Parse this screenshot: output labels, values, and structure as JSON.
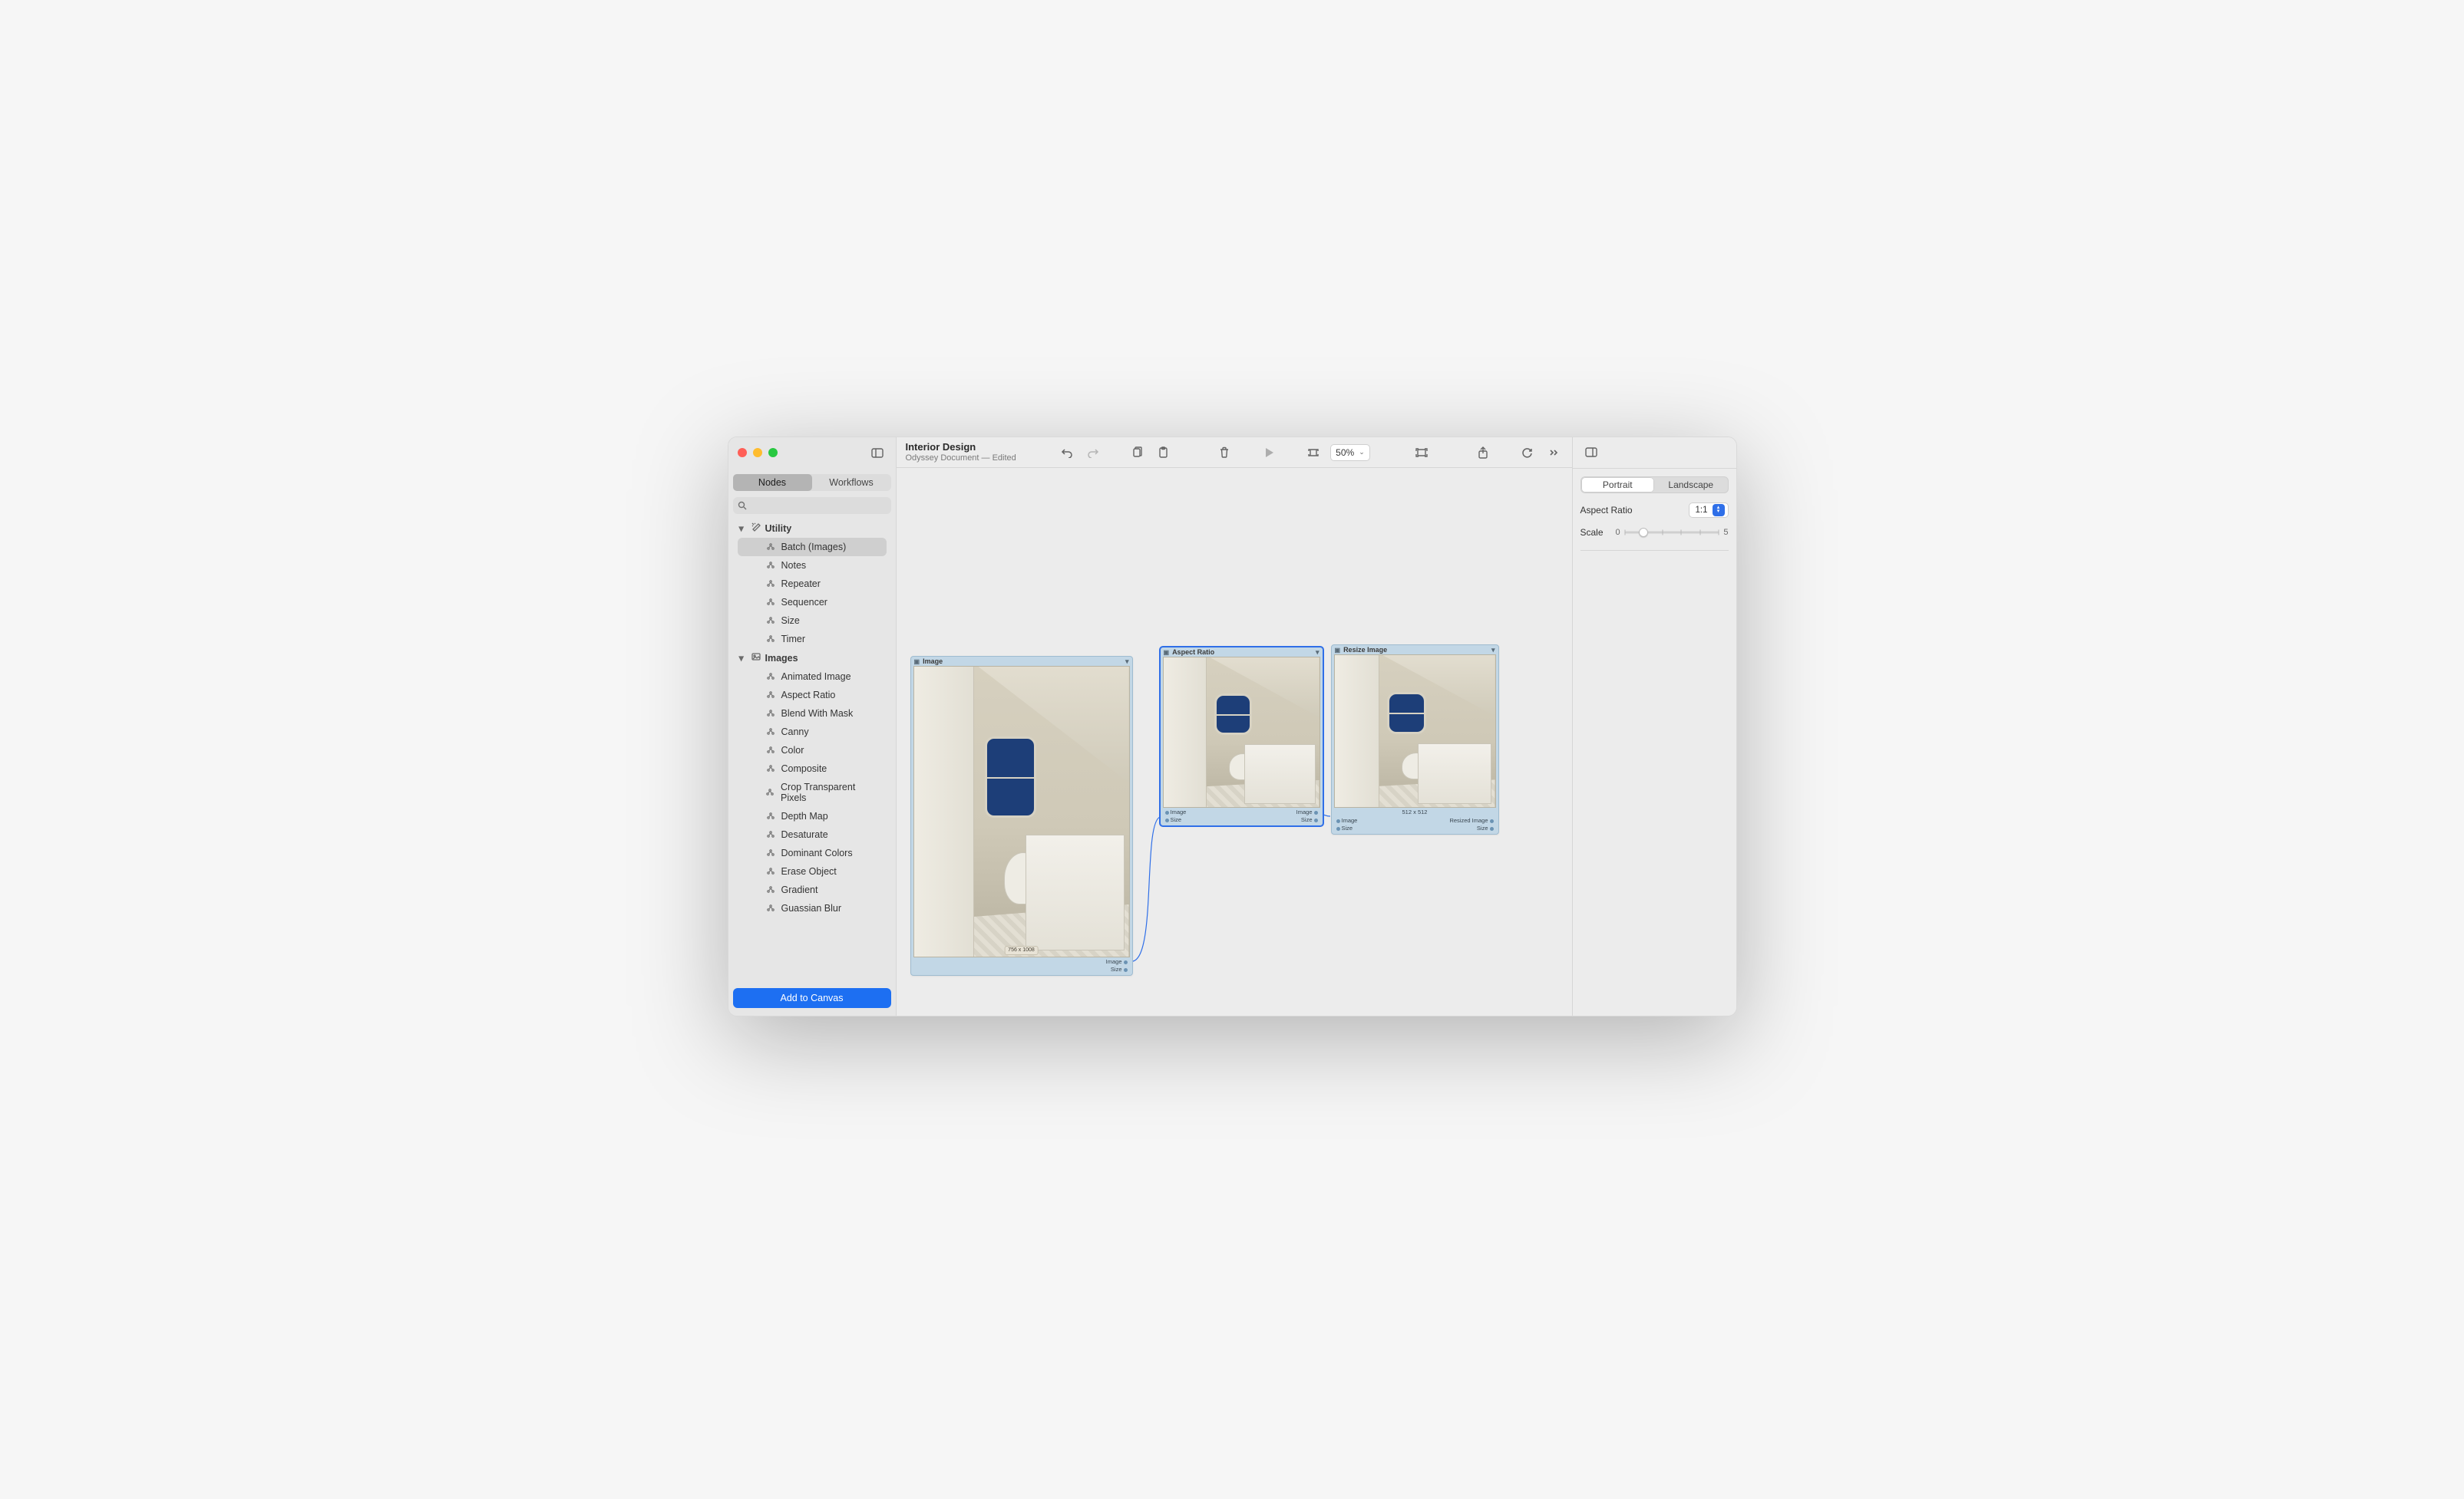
{
  "toolbar": {
    "title": "Interior Design",
    "subtitle": "Odyssey Document — Edited",
    "zoom": "50%"
  },
  "sidebar": {
    "tabs": {
      "nodes": "Nodes",
      "workflows": "Workflows",
      "activeIndex": 0
    },
    "add_button": "Add to Canvas",
    "groups": [
      {
        "name": "Utility",
        "open": true,
        "items": [
          {
            "label": "Batch (Images)",
            "selected": true
          },
          {
            "label": "Notes"
          },
          {
            "label": "Repeater"
          },
          {
            "label": "Sequencer"
          },
          {
            "label": "Size"
          },
          {
            "label": "Timer"
          }
        ]
      },
      {
        "name": "Images",
        "open": true,
        "items": [
          {
            "label": "Animated Image"
          },
          {
            "label": "Aspect Ratio"
          },
          {
            "label": "Blend With Mask"
          },
          {
            "label": "Canny"
          },
          {
            "label": "Color"
          },
          {
            "label": "Composite"
          },
          {
            "label": "Crop Transparent Pixels"
          },
          {
            "label": "Depth Map"
          },
          {
            "label": "Desaturate"
          },
          {
            "label": "Dominant Colors"
          },
          {
            "label": "Erase Object"
          },
          {
            "label": "Gradient"
          },
          {
            "label": "Guassian Blur"
          }
        ]
      }
    ]
  },
  "canvas": {
    "nodes": {
      "image": {
        "title": "Image",
        "badge": "756 x 1008",
        "outputs": [
          "Image",
          "Size"
        ]
      },
      "aspect": {
        "title": "Aspect Ratio",
        "inputs": [
          "Image",
          "Size"
        ],
        "outputs": [
          "Image",
          "Size"
        ]
      },
      "resize": {
        "title": "Resize Image",
        "badge": "512 x 512",
        "inputs": [
          "Image",
          "Size"
        ],
        "outputs": [
          "Resized Image",
          "Size"
        ]
      }
    }
  },
  "inspector": {
    "orientation": {
      "portrait": "Portrait",
      "landscape": "Landscape",
      "activeIndex": 0
    },
    "aspect_label": "Aspect Ratio",
    "aspect_value": "1:1",
    "scale_label": "Scale",
    "scale_min": "0",
    "scale_max": "5"
  }
}
